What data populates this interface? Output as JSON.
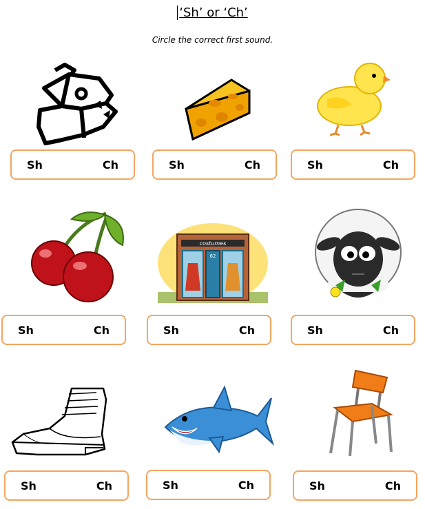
{
  "worksheet": {
    "title": "‘Sh’ or ‘Ch’",
    "instruction": "Circle the correct first sound."
  },
  "items": [
    {
      "picture": "ship-icon",
      "option_a": "Sh",
      "option_b": "Ch"
    },
    {
      "picture": "cheese-icon",
      "option_a": "Sh",
      "option_b": "Ch"
    },
    {
      "picture": "chick-icon",
      "option_a": "Sh",
      "option_b": "Ch"
    },
    {
      "picture": "cherries-icon",
      "option_a": "Sh",
      "option_b": "Ch"
    },
    {
      "picture": "shop-icon",
      "option_a": "Sh",
      "option_b": "Ch",
      "shop_sign": "costumes",
      "shop_number": "62"
    },
    {
      "picture": "sheep-icon",
      "option_a": "Sh",
      "option_b": "Ch"
    },
    {
      "picture": "shoe-icon",
      "option_a": "Sh",
      "option_b": "Ch"
    },
    {
      "picture": "shark-icon",
      "option_a": "Sh",
      "option_b": "Ch"
    },
    {
      "picture": "chair-icon",
      "option_a": "Sh",
      "option_b": "Ch"
    }
  ],
  "colors": {
    "box_border": "#f4a560",
    "cheese": "#f7c320",
    "chick": "#ffe44d",
    "cherry": "#c0121a",
    "chair_seat": "#f07d18",
    "shark": "#3a8fd6"
  }
}
